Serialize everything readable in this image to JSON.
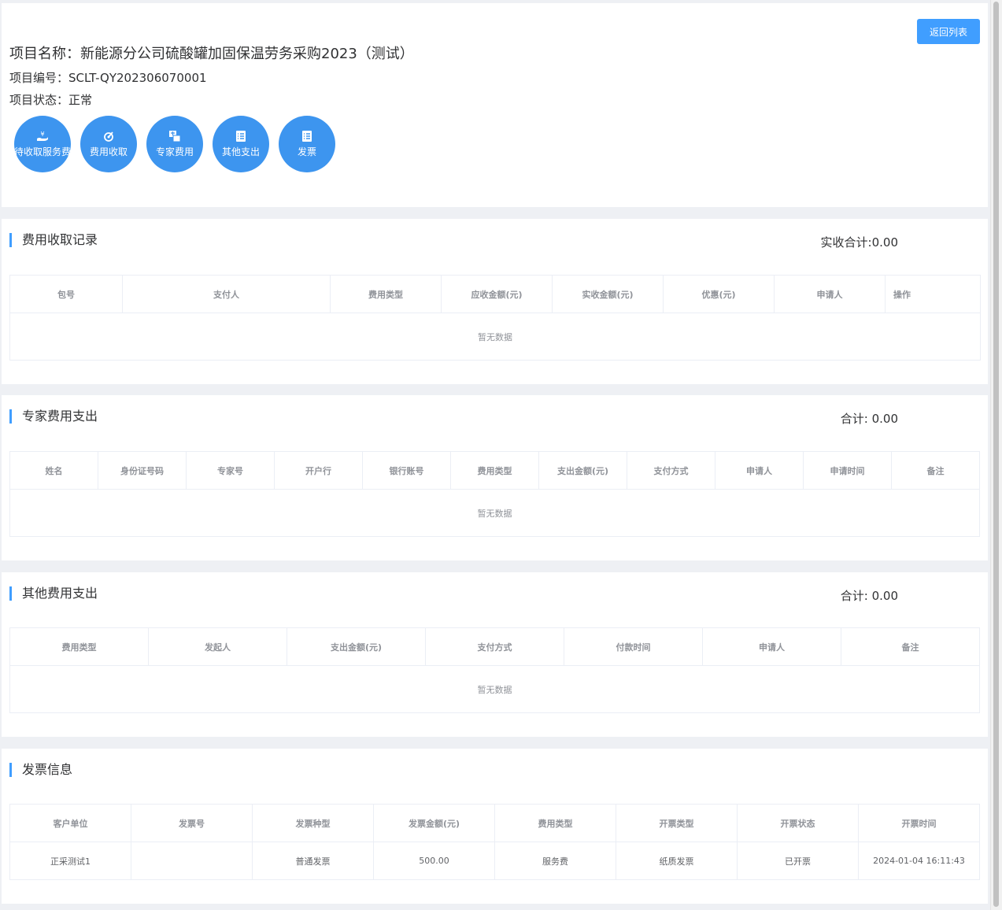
{
  "header": {
    "back_button": "返回列表",
    "project_name": "项目名称：新能源分公司硫酸罐加固保温劳务采购2023（测试）",
    "project_code": "项目编号：SCLT-QY202306070001",
    "project_status": "项目状态：正常",
    "actions": [
      {
        "label": "待收取服务费",
        "icon": "service-fee-icon"
      },
      {
        "label": "费用收取",
        "icon": "fee-collect-icon"
      },
      {
        "label": "专家费用",
        "icon": "expert-fee-icon"
      },
      {
        "label": "其他支出",
        "icon": "other-expense-icon"
      },
      {
        "label": "发票",
        "icon": "invoice-icon"
      }
    ]
  },
  "fee_records": {
    "title": "费用收取记录",
    "total": "实收合计:0.00",
    "columns": [
      "包号",
      "支付人",
      "费用类型",
      "应收金额(元)",
      "实收金额(元)",
      "优惠(元)",
      "申请人",
      "操作"
    ],
    "empty_text": "暂无数据"
  },
  "expert_fees": {
    "title": "专家费用支出",
    "total": "合计: 0.00",
    "columns": [
      "姓名",
      "身份证号码",
      "专家号",
      "开户行",
      "银行账号",
      "费用类型",
      "支出金额(元)",
      "支付方式",
      "申请人",
      "申请时间",
      "备注"
    ],
    "empty_text": "暂无数据"
  },
  "other_fees": {
    "title": "其他费用支出",
    "total": "合计: 0.00",
    "columns": [
      "费用类型",
      "发起人",
      "支出金额(元)",
      "支付方式",
      "付款时间",
      "申请人",
      "备注"
    ],
    "empty_text": "暂无数据"
  },
  "invoices": {
    "title": "发票信息",
    "columns": [
      "客户单位",
      "发票号",
      "发票种型",
      "发票金额(元)",
      "费用类型",
      "开票类型",
      "开票状态",
      "开票时间"
    ],
    "rows": [
      [
        "正采测试1",
        "",
        "普通发票",
        "500.00",
        "服务费",
        "纸质发票",
        "已开票",
        "2024-01-04 16:11:43"
      ]
    ]
  }
}
